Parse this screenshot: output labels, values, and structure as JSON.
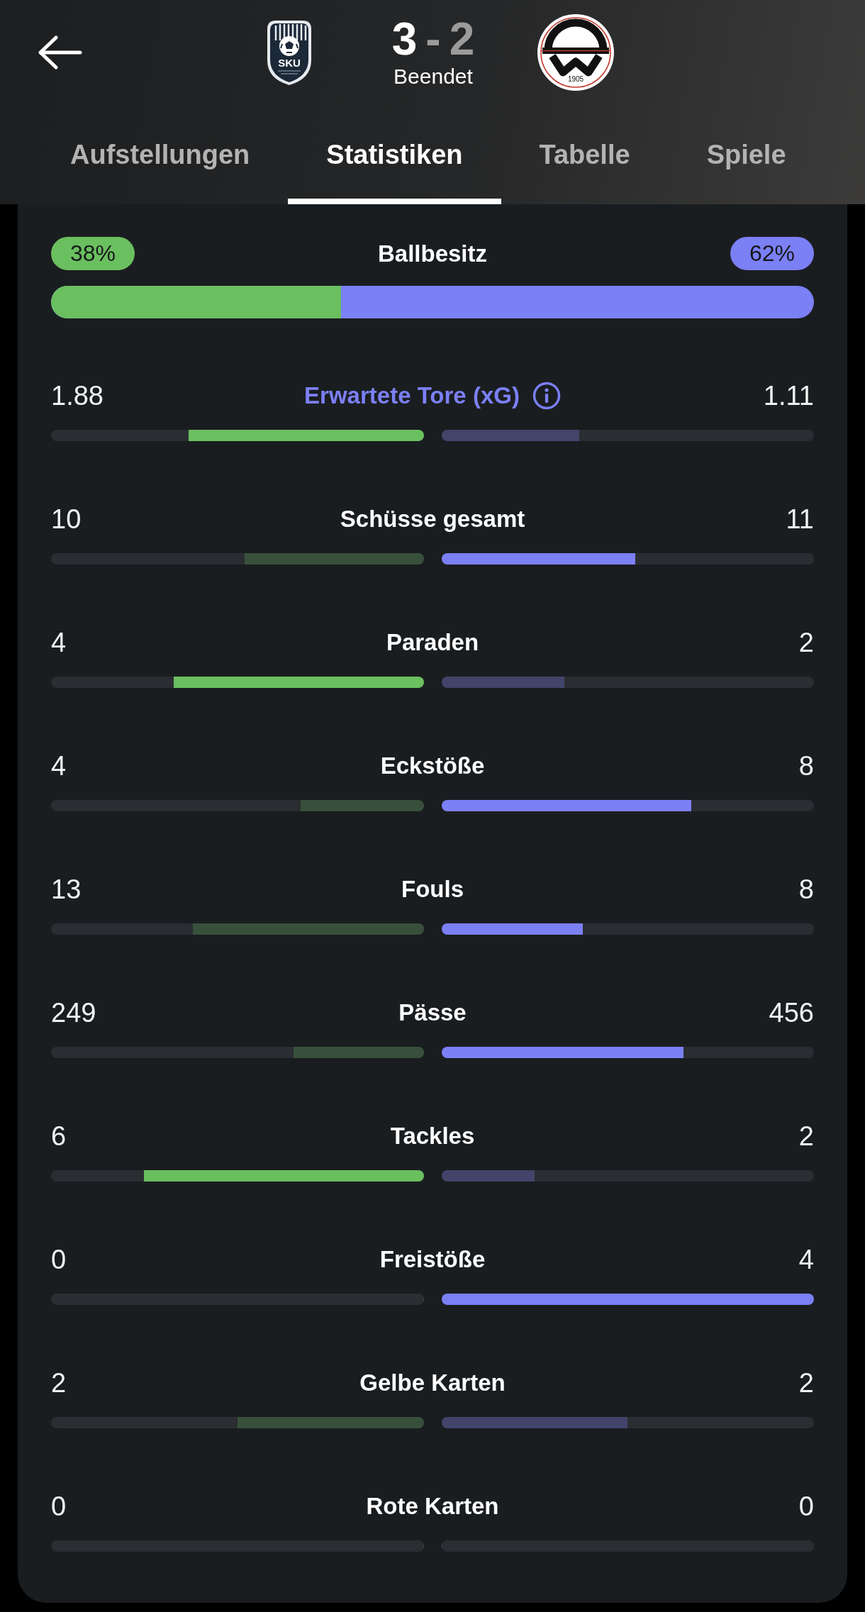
{
  "match": {
    "home_crest_text": "SKU",
    "home_score": {
      "value": "3",
      "winner": true
    },
    "separator": "-",
    "away_score": {
      "value": "2",
      "winner": false
    },
    "status": "Beendet",
    "away_crest_text": "1905"
  },
  "tabs": [
    {
      "label": "Aufstellungen",
      "selected": false
    },
    {
      "label": "Statistiken",
      "selected": true
    },
    {
      "label": "Tabelle",
      "selected": false
    },
    {
      "label": "Spiele",
      "selected": false
    }
  ],
  "possession": {
    "label": "Ballbesitz",
    "home": "38%",
    "away": "62%",
    "level": 0.38
  },
  "stats": [
    {
      "kind": "info",
      "label": "Erwartete Tore (xG)",
      "home": {
        "value": "1.88",
        "level": 0.63,
        "highlighted": true
      },
      "away": {
        "value": "1.11",
        "level": 0.37,
        "highlighted": false
      }
    },
    {
      "kind": "plain",
      "label": "Schüsse gesamt",
      "home": {
        "value": "10",
        "level": 0.48,
        "highlighted": false
      },
      "away": {
        "value": "11",
        "level": 0.52,
        "highlighted": true
      }
    },
    {
      "kind": "plain",
      "label": "Paraden",
      "home": {
        "value": "4",
        "level": 0.67,
        "highlighted": true
      },
      "away": {
        "value": "2",
        "level": 0.33,
        "highlighted": false
      }
    },
    {
      "kind": "plain",
      "label": "Eckstöße",
      "home": {
        "value": "4",
        "level": 0.33,
        "highlighted": false
      },
      "away": {
        "value": "8",
        "level": 0.67,
        "highlighted": true
      }
    },
    {
      "kind": "plain",
      "label": "Fouls",
      "home": {
        "value": "13",
        "level": 0.62,
        "highlighted": false
      },
      "away": {
        "value": "8",
        "level": 0.38,
        "highlighted": true
      }
    },
    {
      "kind": "plain",
      "label": "Pässe",
      "home": {
        "value": "249",
        "level": 0.35,
        "highlighted": false
      },
      "away": {
        "value": "456",
        "level": 0.65,
        "highlighted": true
      }
    },
    {
      "kind": "plain",
      "label": "Tackles",
      "home": {
        "value": "6",
        "level": 0.75,
        "highlighted": true
      },
      "away": {
        "value": "2",
        "level": 0.25,
        "highlighted": false
      }
    },
    {
      "kind": "plain",
      "label": "Freistöße",
      "home": {
        "value": "0",
        "level": 0
      },
      "away": {
        "value": "4",
        "level": 1,
        "highlighted": true
      }
    },
    {
      "kind": "plain",
      "label": "Gelbe Karten",
      "home": {
        "value": "2",
        "level": 0.5,
        "highlighted": false
      },
      "away": {
        "value": "2",
        "level": 0.5,
        "highlighted": false
      }
    },
    {
      "kind": "plain",
      "label": "Rote Karten",
      "home": {
        "value": "0",
        "level": 0
      },
      "away": {
        "value": "0",
        "level": 0
      }
    }
  ]
}
